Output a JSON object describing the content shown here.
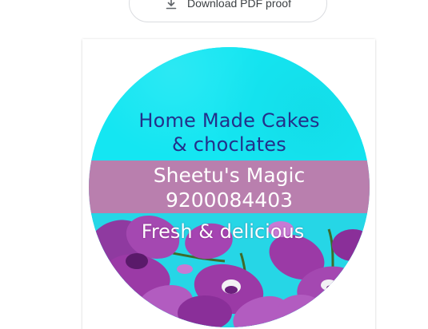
{
  "download_button": {
    "label": "Download PDF proof",
    "icon": "download-icon"
  },
  "sticker": {
    "heading_line1": "Home Made Cakes",
    "heading_line2": "& choclates",
    "brand_name": "Sheetu's Magic",
    "phone": "9200084403",
    "tagline": "Fresh & delicious",
    "colors": {
      "top_background": "#14e6f2",
      "band": "#b97fae",
      "heading_text": "#23308a",
      "band_text": "#ffffff",
      "orchid": "#9b3aa6"
    }
  }
}
